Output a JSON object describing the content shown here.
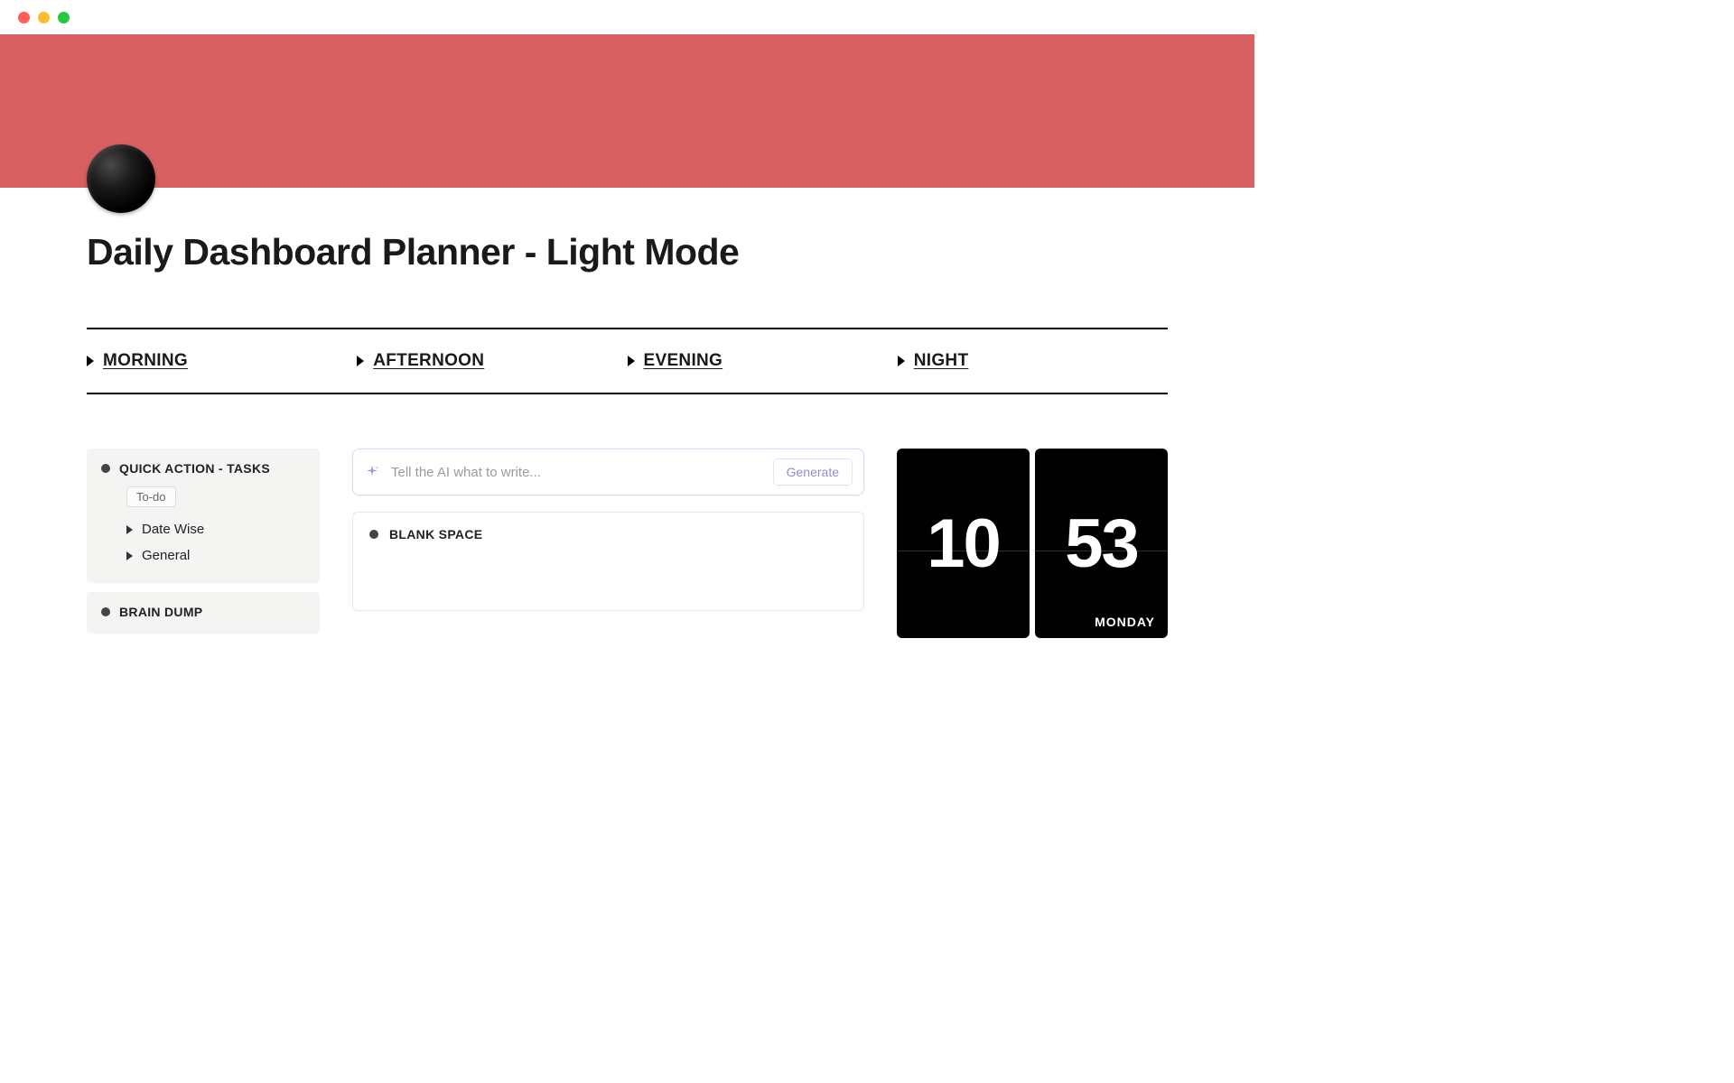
{
  "window": {
    "traffic_lights": [
      "red",
      "yellow",
      "green"
    ]
  },
  "cover": {
    "color": "#d86060"
  },
  "page": {
    "icon_name": "black-circle-icon",
    "title": "Daily Dashboard Planner - Light Mode"
  },
  "time_sections": [
    {
      "label": "MORNING"
    },
    {
      "label": "AFTERNOON"
    },
    {
      "label": "EVENING"
    },
    {
      "label": "NIGHT"
    }
  ],
  "sidebar": {
    "quick_action": {
      "title": "QUICK ACTION - TASKS",
      "pill": "To-do",
      "items": [
        {
          "label": "Date Wise"
        },
        {
          "label": "General"
        }
      ]
    },
    "brain_dump": {
      "title": "BRAIN DUMP"
    }
  },
  "ai": {
    "placeholder": "Tell the AI what to write...",
    "button": "Generate"
  },
  "blank_space": {
    "title": "BLANK SPACE"
  },
  "clock": {
    "hours": "10",
    "minutes": "53",
    "day": "MONDAY"
  }
}
